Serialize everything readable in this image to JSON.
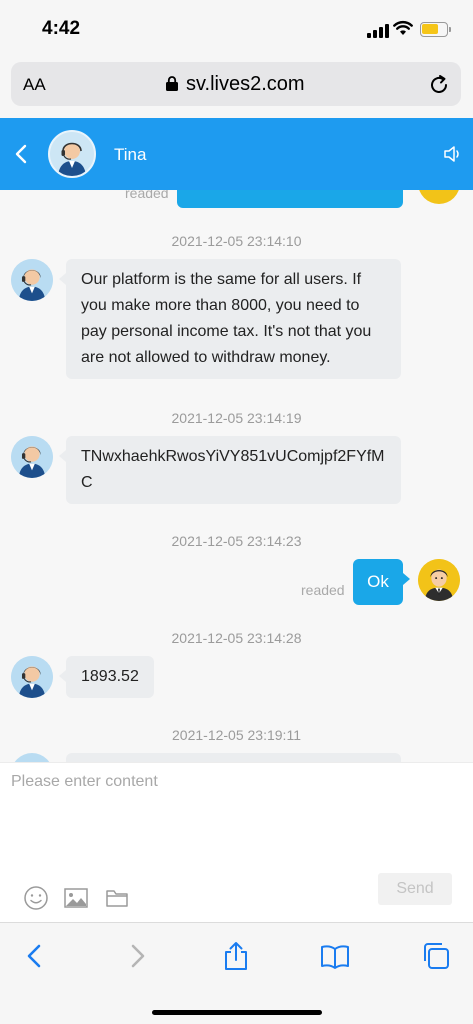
{
  "status_bar": {
    "time": "4:42"
  },
  "browser": {
    "text_size_label": "AA",
    "url": "sv.lives2.com"
  },
  "chat_header": {
    "contact_name": "Tina"
  },
  "messages": [
    {
      "timestamp": "2021-12-05 23:14:10",
      "sender": "agent",
      "text": "Our platform is the same for all users. If you make more than 8000, you need to pay personal income tax. It's not that you are not allowed to withdraw money."
    },
    {
      "timestamp": "2021-12-05 23:14:19",
      "sender": "agent",
      "text": "TNwxhaehkRwosYiVY851vUComjpf2FYfMC"
    },
    {
      "timestamp": "2021-12-05 23:14:23",
      "sender": "user",
      "text": "Ok",
      "status": "readed"
    },
    {
      "timestamp": "2021-12-05 23:14:28",
      "sender": "agent",
      "text": "1893.52"
    },
    {
      "timestamp": "2021-12-05 23:19:11",
      "sender": "agent",
      "text": ""
    }
  ],
  "partial_top": {
    "status": "readed"
  },
  "composer": {
    "placeholder": "Please enter content",
    "send_label": "Send"
  },
  "colors": {
    "header": "#1e9bf0",
    "outgoing_bubble": "#1aa7e8",
    "incoming_bubble": "#ebedef"
  },
  "icons": [
    "back-icon",
    "speaker-icon",
    "emoji-icon",
    "image-icon",
    "folder-icon",
    "lock-icon",
    "reload-icon",
    "share-icon",
    "bookmarks-icon",
    "tabs-icon"
  ]
}
